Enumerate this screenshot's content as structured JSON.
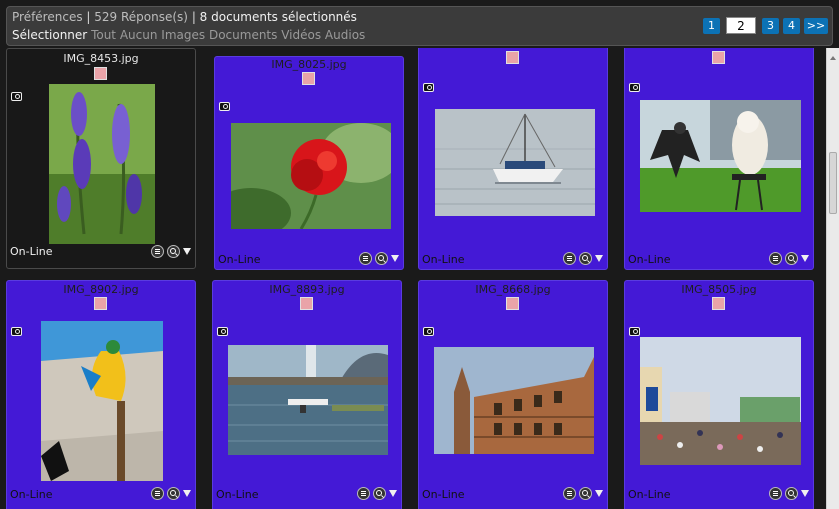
{
  "header": {
    "preferences": "Préférences",
    "responses": "529 Réponse(s)",
    "selected": "8 documents sélectionnés",
    "select_label": "Sélectionner",
    "select_options": [
      "Tout",
      "Aucun",
      "Images",
      "Documents",
      "Vidéos",
      "Audios"
    ]
  },
  "pagination": {
    "page1": "1",
    "current": "2",
    "page3": "3",
    "page4": "4",
    "next": ">>"
  },
  "cards": [
    {
      "filename": "IMG_8453.jpg",
      "status": "On-Line"
    },
    {
      "filename": "IMG_8025.jpg",
      "status": "On-Line"
    },
    {
      "filename": "",
      "status": "On-Line"
    },
    {
      "filename": "",
      "status": "On-Line"
    },
    {
      "filename": "IMG_8902.jpg",
      "status": "On-Line"
    },
    {
      "filename": "IMG_8893.jpg",
      "status": "On-Line"
    },
    {
      "filename": "IMG_8668.jpg",
      "status": "On-Line"
    },
    {
      "filename": "IMG_8505.jpg",
      "status": "On-Line"
    }
  ]
}
